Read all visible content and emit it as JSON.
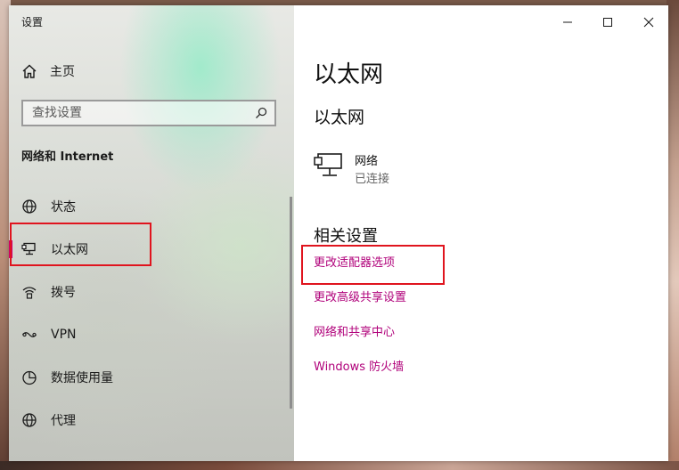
{
  "window": {
    "app_title": "设置",
    "controls": {
      "minimize": "minimize",
      "maximize": "maximize",
      "close": "close"
    }
  },
  "sidebar": {
    "home_label": "主页",
    "search_placeholder": "查找设置",
    "section_title": "网络和 Internet",
    "items": [
      {
        "label": "状态",
        "icon": "globe-icon"
      },
      {
        "label": "以太网",
        "icon": "ethernet-monitor-icon",
        "selected": true
      },
      {
        "label": "拨号",
        "icon": "dialup-icon"
      },
      {
        "label": "VPN",
        "icon": "vpn-icon"
      },
      {
        "label": "数据使用量",
        "icon": "data-usage-icon"
      },
      {
        "label": "代理",
        "icon": "globe-icon"
      }
    ]
  },
  "main": {
    "page_title": "以太网",
    "section_title": "以太网",
    "network": {
      "name": "网络",
      "status": "已连接",
      "icon": "ethernet-monitor-icon"
    },
    "related_title": "相关设置",
    "links": [
      "更改适配器选项",
      "更改高级共享设置",
      "网络和共享中心",
      "Windows 防火墙"
    ]
  },
  "colors": {
    "accent": "#b0007a",
    "selection_bar": "#d0006f",
    "highlight_box": "#e0141e"
  }
}
